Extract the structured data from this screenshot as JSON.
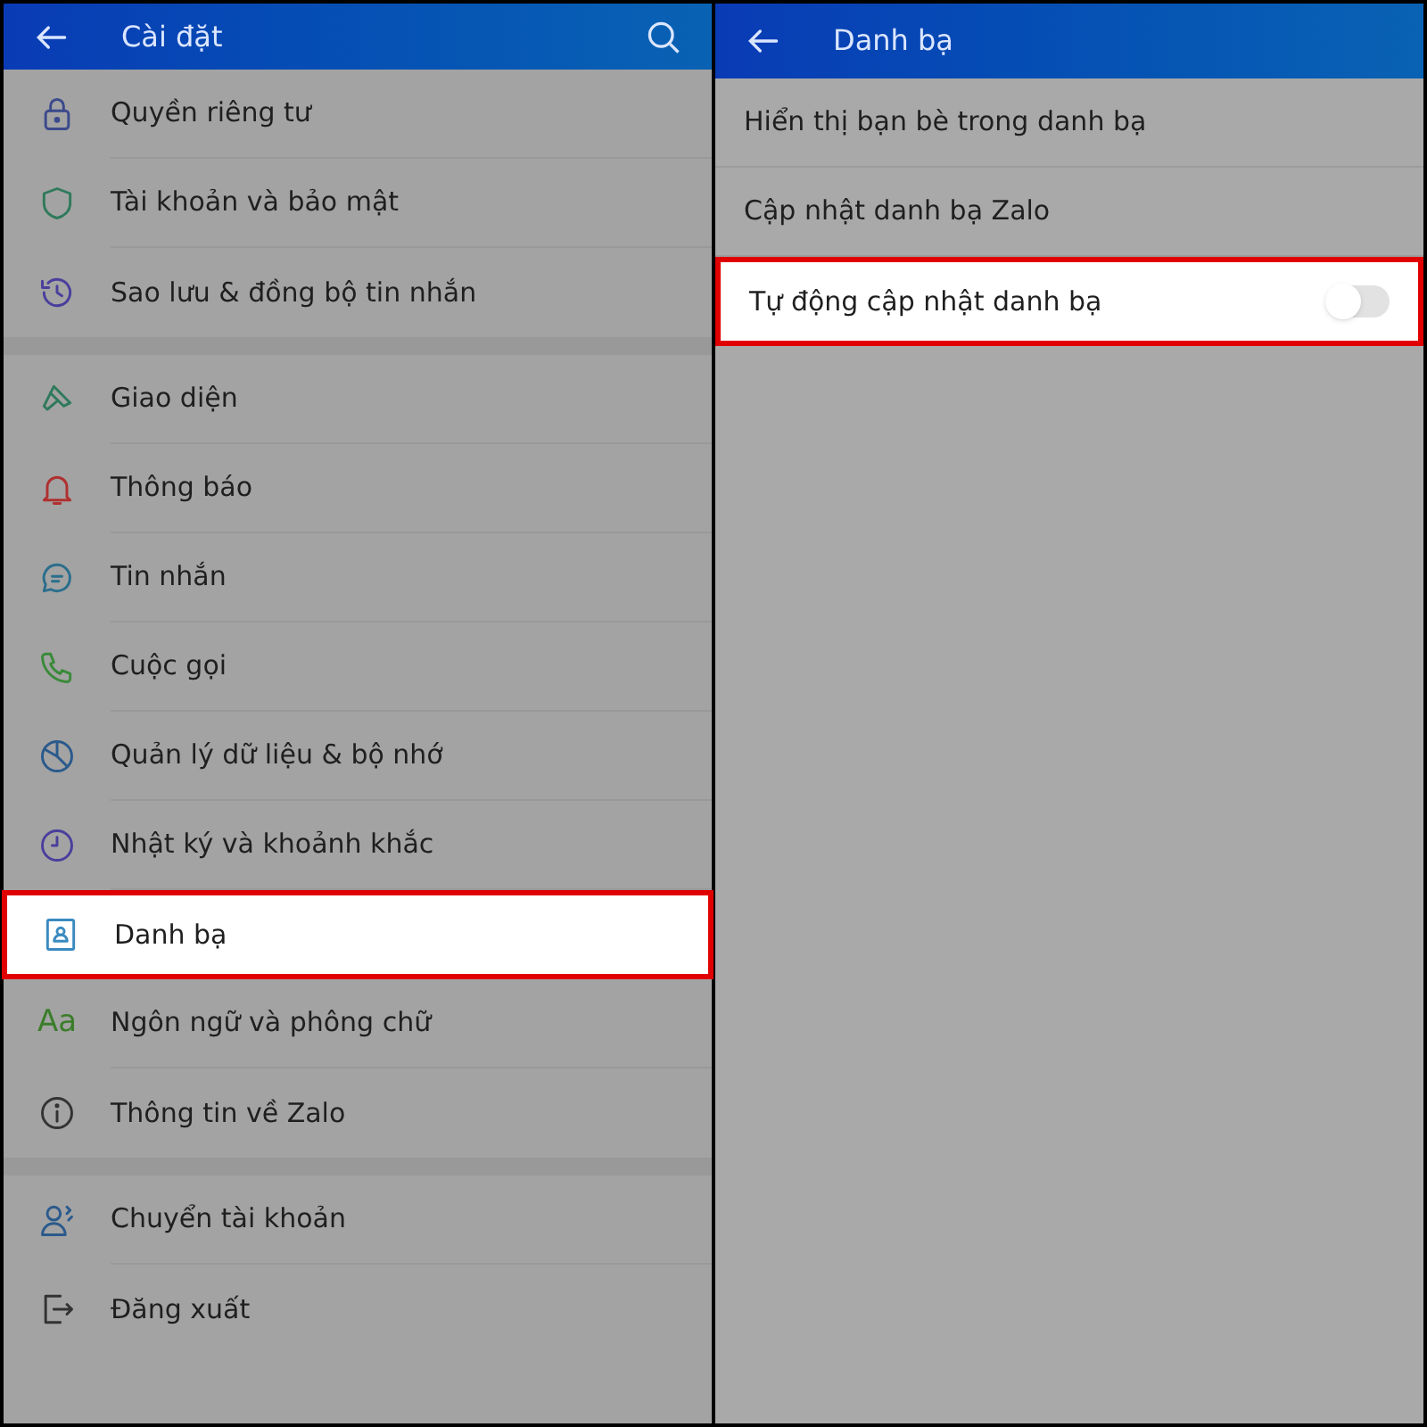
{
  "settings_screen": {
    "title": "Cài đặt",
    "groups": [
      {
        "items": [
          {
            "label": "Quyền riêng tư",
            "highlighted": false
          },
          {
            "label": "Tài khoản và bảo mật",
            "highlighted": false
          },
          {
            "label": "Sao lưu & đồng bộ tin nhắn",
            "highlighted": false
          }
        ]
      },
      {
        "items": [
          {
            "label": "Giao diện",
            "highlighted": false
          },
          {
            "label": "Thông báo",
            "highlighted": false
          },
          {
            "label": "Tin nhắn",
            "highlighted": false
          },
          {
            "label": "Cuộc gọi",
            "highlighted": false
          },
          {
            "label": "Quản lý dữ liệu & bộ nhớ",
            "highlighted": false
          },
          {
            "label": "Nhật ký và khoảnh khắc",
            "highlighted": false
          },
          {
            "label": "Danh bạ",
            "highlighted": true
          },
          {
            "label": "Ngôn ngữ và phông chữ",
            "icon_text": "Aa",
            "highlighted": false
          },
          {
            "label": "Thông tin về Zalo",
            "highlighted": false
          }
        ]
      },
      {
        "items": [
          {
            "label": "Chuyển tài khoản",
            "highlighted": false
          },
          {
            "label": "Đăng xuất",
            "highlighted": false
          }
        ]
      }
    ]
  },
  "contacts_screen": {
    "title": "Danh bạ",
    "items": [
      {
        "kind": "link",
        "label": "Hiển thị bạn bè trong danh bạ",
        "highlighted": false
      },
      {
        "kind": "link",
        "label": "Cập nhật danh bạ Zalo",
        "highlighted": false
      },
      {
        "kind": "toggle",
        "label": "Tự động cập nhật danh bạ",
        "on": false,
        "highlighted": true
      }
    ]
  }
}
